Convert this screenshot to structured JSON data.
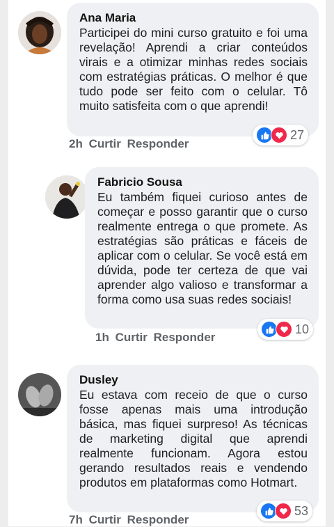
{
  "comments": [
    {
      "author": "Ana Maria",
      "text": "Participei do mini curso gratuito e foi uma revelação! Aprendi a criar conteúdos virais e a otimizar minhas redes sociais com estratégias práticas. O melhor é que tudo pode ser feito com o celular. Tô muito satisfeita com o que aprendi!",
      "time": "2h",
      "like_label": "Curtir",
      "reply_label": "Responder",
      "reactions": [
        "like-icon",
        "love-icon"
      ],
      "reaction_count": "27"
    },
    {
      "author": "Fabricio Sousa",
      "text": "Eu também fiquei curioso antes de começar e posso garantir que o curso realmente entrega o que promete. As estratégias são práticas e fáceis de aplicar com o celular. Se você está em dúvida, pode ter certeza de que vai aprender algo valioso e transformar a forma como usa suas redes sociais!",
      "time": "1h",
      "like_label": "Curtir",
      "reply_label": "Responder",
      "reactions": [
        "like-icon",
        "love-icon"
      ],
      "reaction_count": "10"
    },
    {
      "author": "Dusley",
      "text": "Eu estava com receio de que o curso fosse apenas mais uma introdução básica, mas fiquei surpreso! As técnicas de marketing digital que aprendi realmente funcionam. Agora estou gerando resultados reais e vendendo produtos em plataformas como Hotmart.",
      "time": "7h",
      "like_label": "Curtir",
      "reply_label": "Responder",
      "reactions": [
        "like-icon",
        "love-icon"
      ],
      "reaction_count": "53"
    }
  ],
  "colors": {
    "bubble": "#eff0f3",
    "like": "#1877f2",
    "love": "#f0284a",
    "meta_text": "#5f6368"
  }
}
